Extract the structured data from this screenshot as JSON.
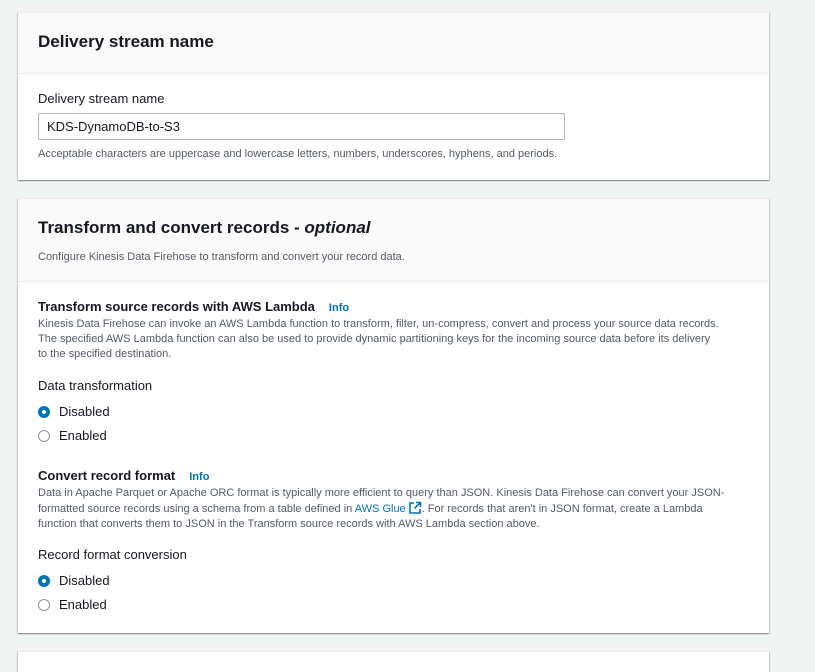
{
  "stream_section": {
    "title": "Delivery stream name",
    "field_label": "Delivery stream name",
    "field_value": "KDS-DynamoDB-to-S3",
    "field_hint": "Acceptable characters are uppercase and lowercase letters, numbers, underscores, hyphens, and periods."
  },
  "transform_section": {
    "title_main": "Transform and convert records - ",
    "title_optional": "optional",
    "description": "Configure Kinesis Data Firehose to transform and convert your record data.",
    "lambda": {
      "title": "Transform source records with AWS Lambda",
      "info": "Info",
      "description_lines": [
        "Kinesis Data Firehose can invoke an AWS Lambda function to transform, filter, un-compress, convert and process your source data records.",
        "The specified AWS Lambda function can also be used to provide dynamic partitioning keys for the incoming source data before its delivery",
        "to the specified destination."
      ],
      "radio_group_label": "Data transformation",
      "options": [
        "Disabled",
        "Enabled"
      ],
      "selected": "Disabled"
    },
    "convert": {
      "title": "Convert record format",
      "info": "Info",
      "description_line1": "Data in Apache Parquet or Apache ORC format is typically more efficient to query than JSON. Kinesis Data Firehose can convert your JSON-",
      "description_line2_before": "formatted source records using a schema from a table defined in ",
      "glue_link": "AWS Glue",
      "description_line2_after": ". For records that aren't in JSON format, create a Lambda",
      "description_line3": "function that converts them to JSON in the Transform source records with AWS Lambda section above.",
      "radio_group_label": "Record format conversion",
      "options": [
        "Disabled",
        "Enabled"
      ],
      "selected": "Disabled"
    }
  },
  "colors": {
    "accent": "#0073bb",
    "background": "#f2f3f3",
    "text": "#16191f",
    "muted": "#545b64"
  }
}
